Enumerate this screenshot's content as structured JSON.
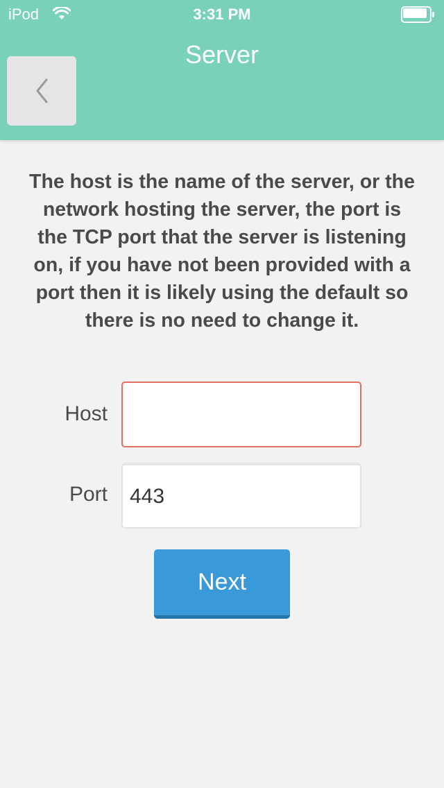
{
  "status_bar": {
    "carrier": "iPod",
    "time": "3:31 PM"
  },
  "header": {
    "title": "Server"
  },
  "description": "The host is the name of the server, or the network hosting the server, the port is the TCP port that the server is listening on, if you have not been provided with a port then it is likely using the default so there is no need to change it.",
  "form": {
    "host_label": "Host",
    "host_value": "",
    "port_label": "Port",
    "port_value": "443"
  },
  "next_label": "Next",
  "colors": {
    "header": "#78d1b8",
    "accent": "#3a99d8",
    "error_border": "#e6705f"
  },
  "icons": {
    "back": "chevron-left-icon",
    "wifi": "wifi-icon",
    "battery": "battery-icon"
  }
}
